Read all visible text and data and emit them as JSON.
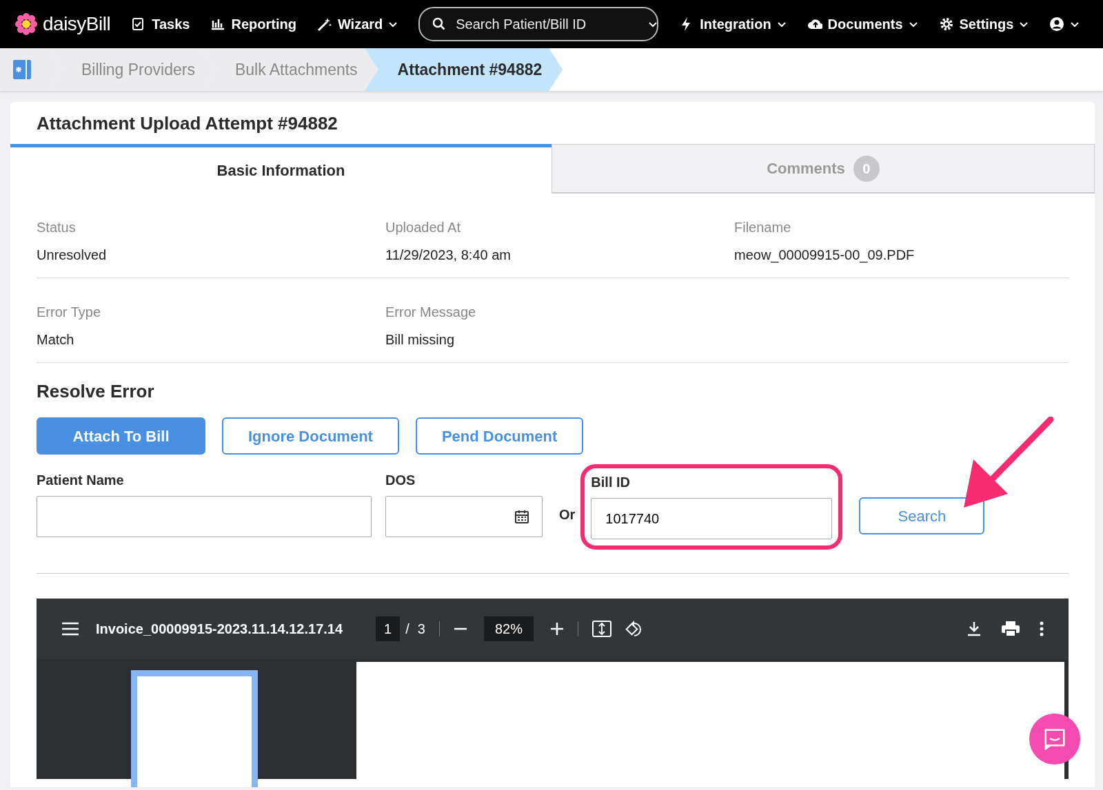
{
  "nav": {
    "brand": "daisyBill",
    "items": [
      {
        "label": "Tasks",
        "dropdown": false
      },
      {
        "label": "Reporting",
        "dropdown": false
      },
      {
        "label": "Wizard",
        "dropdown": true
      }
    ],
    "search": {
      "placeholder": "Search Patient/Bill ID"
    },
    "right_items": [
      {
        "label": "Integration",
        "dropdown": true
      },
      {
        "label": "Documents",
        "dropdown": true
      },
      {
        "label": "Settings",
        "dropdown": true
      },
      {
        "dropdown": true
      }
    ]
  },
  "breadcrumb": [
    {
      "label": "Billing Providers",
      "selected": false
    },
    {
      "label": "Bulk Attachments",
      "selected": false
    },
    {
      "label": "Attachment #94882",
      "selected": true
    }
  ],
  "title": "Attachment Upload Attempt #94882",
  "tabs": [
    {
      "label": "Basic Information",
      "selected": true
    },
    {
      "label": "Comments",
      "badge": "0",
      "selected": false
    }
  ],
  "info_rows": [
    [
      {
        "label": "Status",
        "value": "Unresolved"
      },
      {
        "label": "Uploaded At",
        "value": "11/29/2023, 8:40 am"
      },
      {
        "label": "Filename",
        "value": "meow_00009915-00_09.PDF"
      }
    ],
    [
      {
        "label": "Error Type",
        "value": "Match"
      },
      {
        "label": "Error Message",
        "value": "Bill missing"
      }
    ]
  ],
  "resolve": {
    "heading": "Resolve Error",
    "actions": [
      {
        "label": "Attach To Bill",
        "kind": "primary"
      },
      {
        "label": "Ignore Document",
        "kind": "outline"
      },
      {
        "label": "Pend Document",
        "kind": "outline"
      }
    ],
    "fields": [
      {
        "kind": "text",
        "label": "Patient Name"
      },
      {
        "kind": "date",
        "label": "DOS"
      },
      {
        "kind": "separator",
        "label": "Or"
      },
      {
        "kind": "text",
        "label": "Bill ID",
        "value": "1017740",
        "highlighted": true
      }
    ],
    "search_button": "Search"
  },
  "viewer": {
    "filename": "Invoice_00009915-2023.11.14.12.17.14",
    "page": "1",
    "page_separator": "/",
    "page_total": "3",
    "zoom": "82%"
  },
  "callouts": [
    {
      "kind": "arrow"
    }
  ]
}
